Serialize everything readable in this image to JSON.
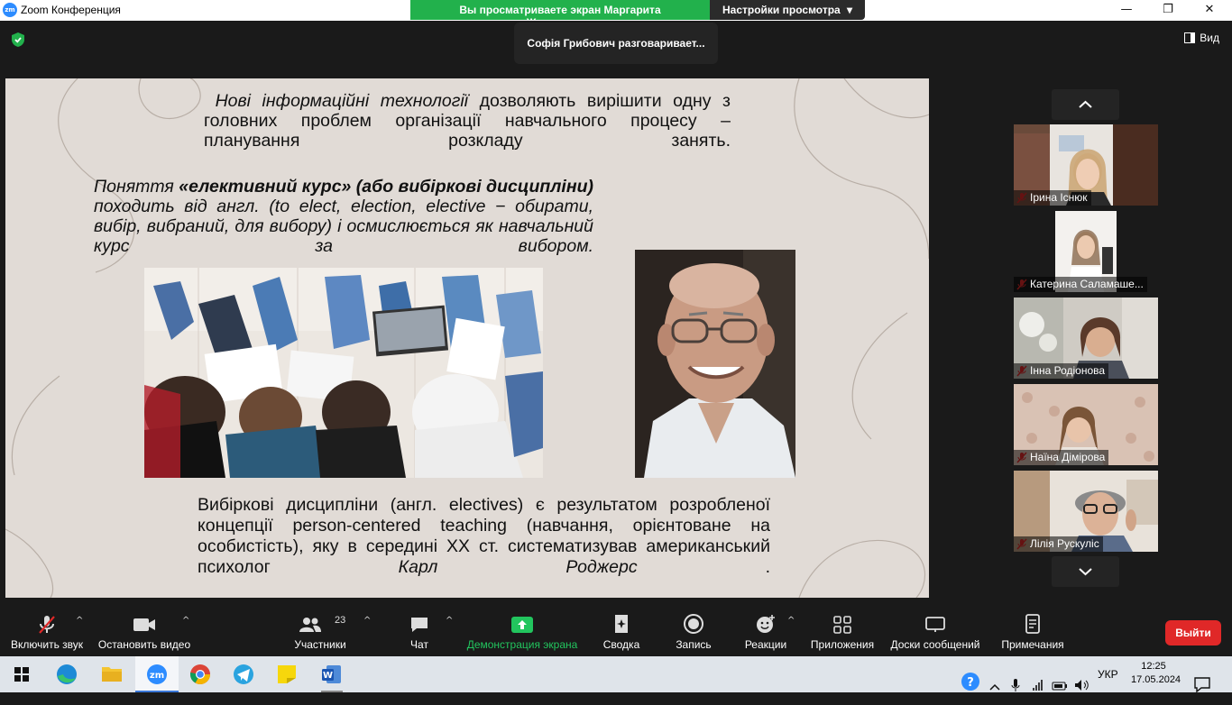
{
  "window": {
    "title": "Zoom Конференция",
    "logo_text": "zm",
    "controls": [
      "—",
      "❐",
      "✕"
    ]
  },
  "banner": {
    "viewing_text": "Вы просматриваете экран Маргарита Журавльова",
    "settings_label": "Настройки просмотра"
  },
  "top": {
    "speaking_text": "Софія Грибович разговаривает...",
    "view_label": "Вид"
  },
  "slide": {
    "p1_italic": "Нові інформаційні технології",
    "p1_rest": " дозволяють вирішити одну з головних проблем організації навчального процесу – планування розкладу занять.",
    "p2_start": "Поняття ",
    "p2_bold": "«елективний курс» (або вибіркові дисципліни)",
    "p2_rest": " походить від англ. (to elect, election, elective − обирати, вибір, вибраний, для вибору) і осмислюється як навчальний курс за вибором.",
    "p3_main": "Вибіркові дисципліни (англ. electives) є результатом розробленої концепції person-centered teaching (навчання, орієнтоване на особистість), яку в середині ХХ ст. систематизував американський психолог ",
    "p3_italic": "Карл Роджерс",
    "p3_end": " ."
  },
  "participants": [
    {
      "name": "Ірина Існюк"
    },
    {
      "name": "Катерина Саламаше..."
    },
    {
      "name": "Інна Родіонова"
    },
    {
      "name": "Наїна Дімірова"
    },
    {
      "name": "Лілія Рускуліс"
    }
  ],
  "toolbar": {
    "mute": "Включить звук",
    "video": "Остановить видео",
    "participants": "Участники",
    "participants_count": "23",
    "chat": "Чат",
    "share": "Демонстрация экрана",
    "summary": "Сводка",
    "record": "Запись",
    "reactions": "Реакции",
    "apps": "Приложения",
    "boards": "Доски сообщений",
    "notes": "Примечания",
    "leave": "Выйти"
  },
  "taskbar": {
    "lang": "УКР",
    "time": "12:25",
    "date": "17.05.2024"
  },
  "colors": {
    "green": "#22b14c",
    "share_green": "#22c55e",
    "leave_red": "#e02828",
    "slide_bg": "#e1dbd6"
  }
}
